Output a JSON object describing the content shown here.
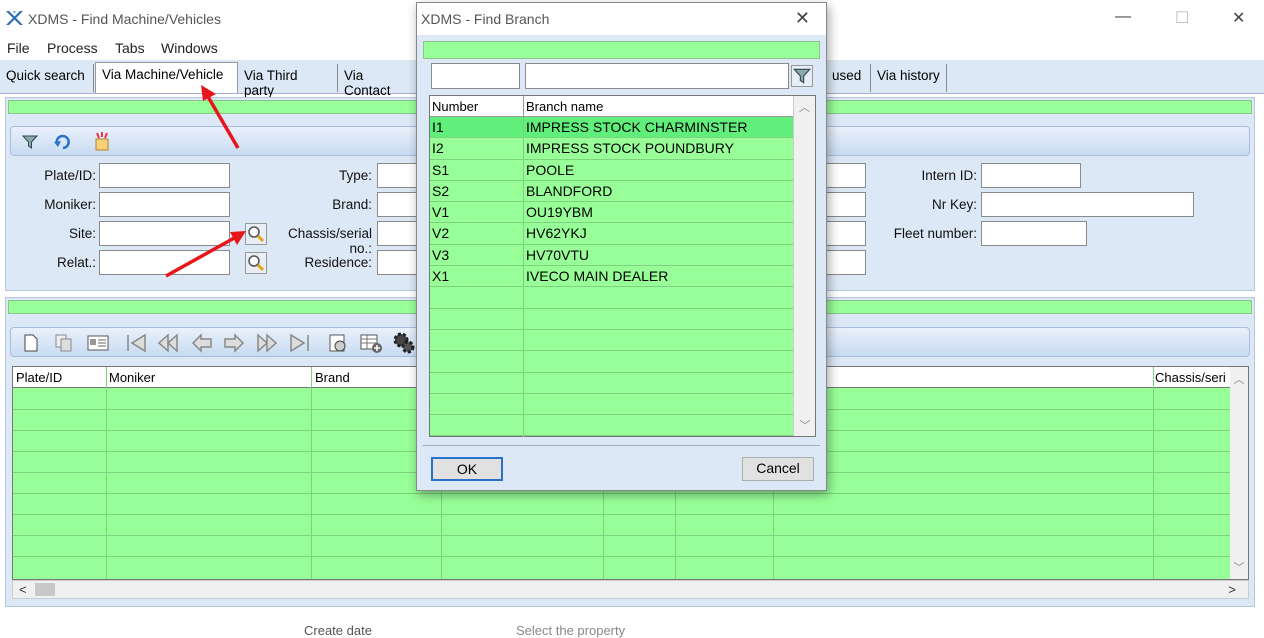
{
  "window": {
    "title": "XDMS  -  Find Machine/Vehicles",
    "minimize": "—",
    "maximize": "☐",
    "close": "✕"
  },
  "menu": [
    "File",
    "Process",
    "Tabs",
    "Windows"
  ],
  "tabs": [
    {
      "label": "Quick search"
    },
    {
      "label": "Via Machine/Vehicle"
    },
    {
      "label": "Via Third party"
    },
    {
      "label": "Via Contact"
    },
    {
      "label": "used"
    },
    {
      "label": "Via history"
    }
  ],
  "search": {
    "labels": {
      "plate": "Plate/ID:",
      "moniker": "Moniker:",
      "site": "Site:",
      "relat": "Relat.:",
      "type": "Type:",
      "brand": "Brand:",
      "chassis": "Chassis/serial no.:",
      "residence": "Residence:",
      "intern_id": "Intern ID:",
      "nr_key": "Nr Key:",
      "fleet_number": "Fleet number:"
    }
  },
  "results": {
    "columns": [
      "Plate/ID",
      "Moniker",
      "Brand",
      "Chassis/seri"
    ]
  },
  "status": {
    "left": "Create date",
    "right": "Select the property"
  },
  "dialog": {
    "title": "XDMS  -  Find Branch",
    "columns": {
      "number": "Number",
      "name": "Branch name"
    },
    "rows": [
      {
        "number": "I1",
        "name": "IMPRESS STOCK CHARMINSTER"
      },
      {
        "number": "I2",
        "name": "IMPRESS STOCK POUNDBURY"
      },
      {
        "number": "S1",
        "name": "POOLE"
      },
      {
        "number": "S2",
        "name": "BLANDFORD"
      },
      {
        "number": "V1",
        "name": "OU19YBM"
      },
      {
        "number": "V2",
        "name": "HV62YKJ"
      },
      {
        "number": "V3",
        "name": "HV70VTU"
      },
      {
        "number": "X1",
        "name": "IVECO MAIN DEALER"
      }
    ],
    "ok_label": "OK",
    "cancel_label": "Cancel"
  },
  "colors": {
    "grid_green": "#98ff98",
    "selected_row": "#5fef7a",
    "panel_blue": "#dce8f5",
    "annotation_arrow": "#e8161b"
  }
}
